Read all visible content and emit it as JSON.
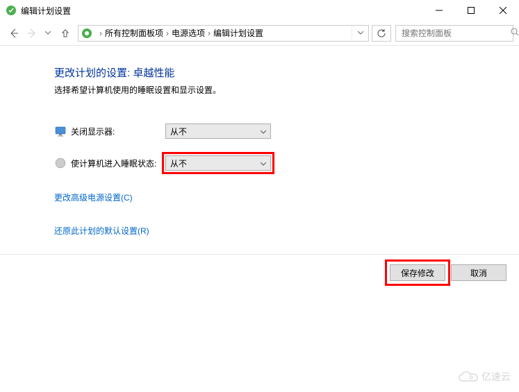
{
  "window": {
    "title": "编辑计划设置"
  },
  "nav": {
    "breadcrumb": {
      "seg1": "所有控制面板项",
      "seg2": "电源选项",
      "seg3": "编辑计划设置"
    },
    "search_placeholder": "搜索控制面板"
  },
  "page": {
    "title": "更改计划的设置: 卓越性能",
    "description": "选择希望计算机使用的睡眠设置和显示设置。"
  },
  "settings": {
    "display_off": {
      "label": "关闭显示器:",
      "value": "从不"
    },
    "sleep": {
      "label": "使计算机进入睡眠状态:",
      "value": "从不"
    }
  },
  "links": {
    "advanced": "更改高级电源设置(C)",
    "restore": "还原此计划的默认设置(R)"
  },
  "buttons": {
    "save": "保存修改",
    "cancel": "取消"
  },
  "watermark": {
    "text": "亿速云"
  }
}
